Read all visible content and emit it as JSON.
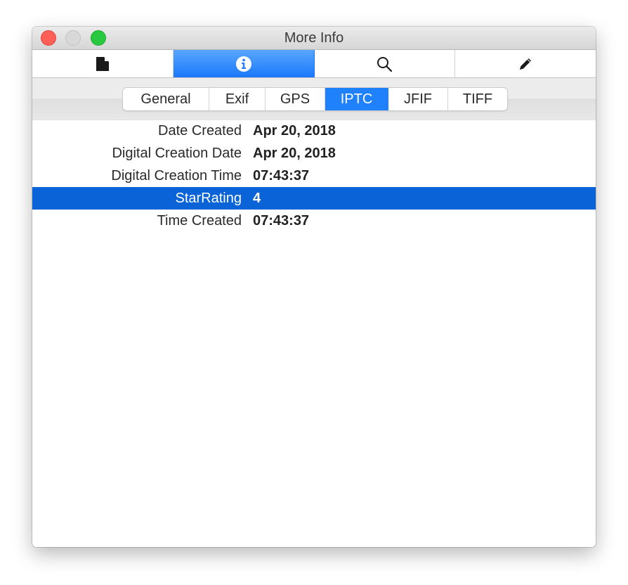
{
  "window": {
    "title": "More Info"
  },
  "toolbar": {
    "buttons": [
      {
        "icon": "document-icon",
        "active": false
      },
      {
        "icon": "info-icon",
        "active": true
      },
      {
        "icon": "search-icon",
        "active": false
      },
      {
        "icon": "pencil-icon",
        "active": false
      }
    ]
  },
  "tabs": [
    {
      "label": "General"
    },
    {
      "label": "Exif"
    },
    {
      "label": "GPS"
    },
    {
      "label": "IPTC",
      "selected": true
    },
    {
      "label": "JFIF"
    },
    {
      "label": "TIFF"
    }
  ],
  "rows": [
    {
      "label": "Date Created",
      "value": "Apr 20, 2018"
    },
    {
      "label": "Digital Creation Date",
      "value": "Apr 20, 2018"
    },
    {
      "label": "Digital Creation Time",
      "value": "07:43:37"
    },
    {
      "label": "StarRating",
      "value": "4",
      "selected": true
    },
    {
      "label": "Time Created",
      "value": "07:43:37"
    }
  ],
  "colors": {
    "accent": "#1f81fb",
    "selection": "#0a64d8"
  }
}
